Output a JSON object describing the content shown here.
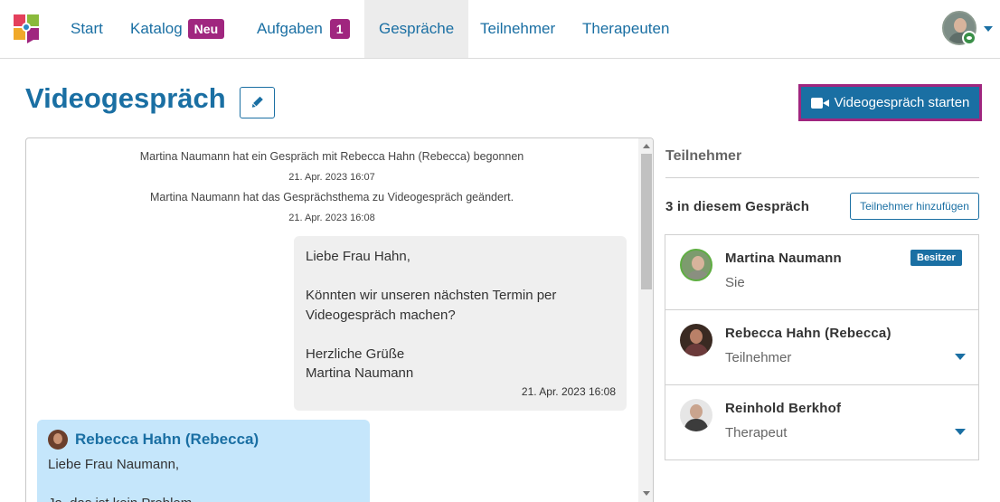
{
  "nav": {
    "items": [
      {
        "label": "Start"
      },
      {
        "label": "Katalog",
        "badge": "Neu"
      },
      {
        "label": "Aufgaben",
        "badge": "1"
      },
      {
        "label": "Gespräche",
        "active": true
      },
      {
        "label": "Teilnehmer"
      },
      {
        "label": "Therapeuten"
      }
    ],
    "colors": {
      "link": "#1a6fa3",
      "badge": "#a0267f",
      "active_bg": "#ececec"
    }
  },
  "page": {
    "title": "Videogespräch",
    "start_button": "Videogespräch starten"
  },
  "chat": {
    "system_messages": [
      {
        "text": "Martina Naumann hat ein Gespräch mit Rebecca Hahn (Rebecca) begonnen",
        "time": "21. Apr. 2023 16:07"
      },
      {
        "text": "Martina Naumann hat das Gesprächsthema zu Videogespräch geändert.",
        "time": "21. Apr. 2023 16:08"
      }
    ],
    "my_message": {
      "line1": "Liebe Frau Hahn,",
      "line2": "Könnten wir unseren nächsten Termin per",
      "line3": "Videogespräch machen?",
      "line4": "Herzliche Grüße",
      "line5": "Martina Naumann",
      "time": "21. Apr. 2023 16:08"
    },
    "other_message": {
      "sender": "Rebecca Hahn (Rebecca)",
      "line1": "Liebe Frau Naumann,",
      "line2": "Ja, das ist kein Problem."
    }
  },
  "participants": {
    "title": "Teilnehmer",
    "count_label": "3 in diesem Gespräch",
    "add_button": "Teilnehmer hinzufügen",
    "list": [
      {
        "name": "Martina Naumann",
        "role": "Sie",
        "badge": "Besitzer"
      },
      {
        "name": "Rebecca Hahn (Rebecca)",
        "role": "Teilnehmer"
      },
      {
        "name": "Reinhold Berkhof",
        "role": "Therapeut"
      }
    ]
  },
  "icons": [
    "logo-icon",
    "pencil-icon",
    "video-camera-icon",
    "user-avatar",
    "eye-icon",
    "chevron-down-icon"
  ]
}
